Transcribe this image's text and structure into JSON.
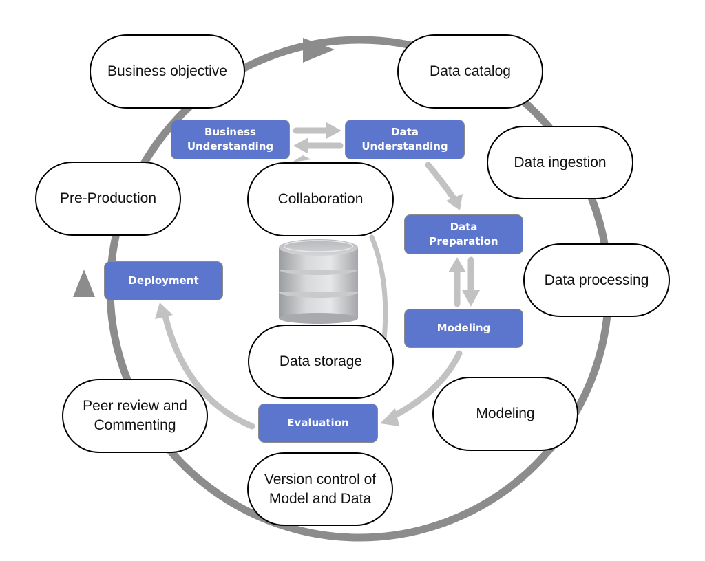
{
  "diagram": {
    "outer_cycle": {
      "direction": "clockwise",
      "color": "#8c8c8c",
      "nodes": [
        {
          "id": "business-objective",
          "label": "Business objective"
        },
        {
          "id": "data-catalog",
          "label": "Data catalog"
        },
        {
          "id": "data-ingestion",
          "label": "Data ingestion"
        },
        {
          "id": "data-processing",
          "label": "Data processing"
        },
        {
          "id": "modeling-outer",
          "label": "Modeling"
        },
        {
          "id": "version-control",
          "label": "Version control of\nModel and Data"
        },
        {
          "id": "peer-review",
          "label": "Peer review and\nCommenting"
        },
        {
          "id": "pre-production",
          "label": "Pre-Production"
        }
      ]
    },
    "inner_nodes": [
      {
        "id": "collaboration",
        "label": "Collaboration"
      },
      {
        "id": "data-storage",
        "label": "Data storage"
      }
    ],
    "center_icon": "database-icon",
    "crisp_dm": {
      "color": "#5b76cc",
      "arrow_color": "#c2c2c2",
      "phases": [
        {
          "id": "business-understanding",
          "label": "Business\nUnderstanding"
        },
        {
          "id": "data-understanding",
          "label": "Data\nUnderstanding"
        },
        {
          "id": "data-preparation",
          "label": "Data\nPreparation"
        },
        {
          "id": "modeling",
          "label": "Modeling"
        },
        {
          "id": "evaluation",
          "label": "Evaluation"
        },
        {
          "id": "deployment",
          "label": "Deployment"
        }
      ],
      "flows": [
        {
          "from": "business-understanding",
          "to": "data-understanding"
        },
        {
          "from": "data-understanding",
          "to": "business-understanding"
        },
        {
          "from": "data-understanding",
          "to": "data-preparation"
        },
        {
          "from": "data-preparation",
          "to": "modeling"
        },
        {
          "from": "modeling",
          "to": "data-preparation"
        },
        {
          "from": "modeling",
          "to": "evaluation"
        },
        {
          "from": "evaluation",
          "to": "deployment"
        },
        {
          "from": "evaluation",
          "to": "business-understanding"
        }
      ]
    }
  }
}
